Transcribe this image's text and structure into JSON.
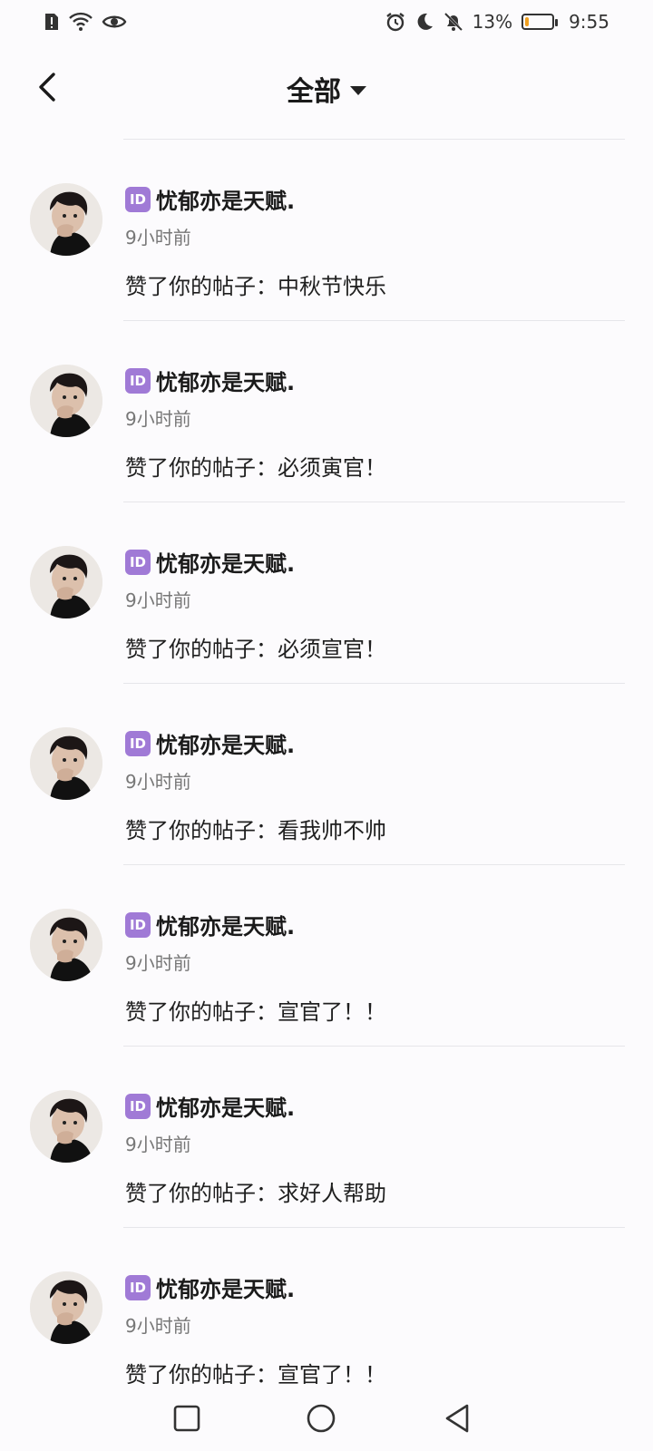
{
  "status_bar": {
    "battery_percent": "13%",
    "time": "9:55",
    "battery_level": 0.13,
    "icons_left": [
      "sim-alert-icon",
      "wifi-icon",
      "eye-icon"
    ],
    "icons_right": [
      "alarm-icon",
      "moon-icon",
      "bell-off-icon",
      "battery-icon"
    ]
  },
  "header": {
    "title": "全部",
    "back_icon": "chevron-left-icon",
    "dropdown_icon": "caret-down-icon"
  },
  "notifications": [
    {
      "badge": "ID",
      "name": "忧郁亦是天赋.",
      "time": "9小时前",
      "message": "赞了你的帖子：中秋节快乐"
    },
    {
      "badge": "ID",
      "name": "忧郁亦是天赋.",
      "time": "9小时前",
      "message": "赞了你的帖子：必须寅官！"
    },
    {
      "badge": "ID",
      "name": "忧郁亦是天赋.",
      "time": "9小时前",
      "message": "赞了你的帖子：必须宣官！"
    },
    {
      "badge": "ID",
      "name": "忧郁亦是天赋.",
      "time": "9小时前",
      "message": "赞了你的帖子：看我帅不帅"
    },
    {
      "badge": "ID",
      "name": "忧郁亦是天赋.",
      "time": "9小时前",
      "message": "赞了你的帖子：宣官了！！"
    },
    {
      "badge": "ID",
      "name": "忧郁亦是天赋.",
      "time": "9小时前",
      "message": "赞了你的帖子：求好人帮助"
    },
    {
      "badge": "ID",
      "name": "忧郁亦是天赋.",
      "time": "9小时前",
      "message": "赞了你的帖子：宣官了！！"
    }
  ],
  "nav_bar": {
    "icons": [
      "recents-square-icon",
      "home-circle-icon",
      "back-triangle-icon"
    ]
  }
}
